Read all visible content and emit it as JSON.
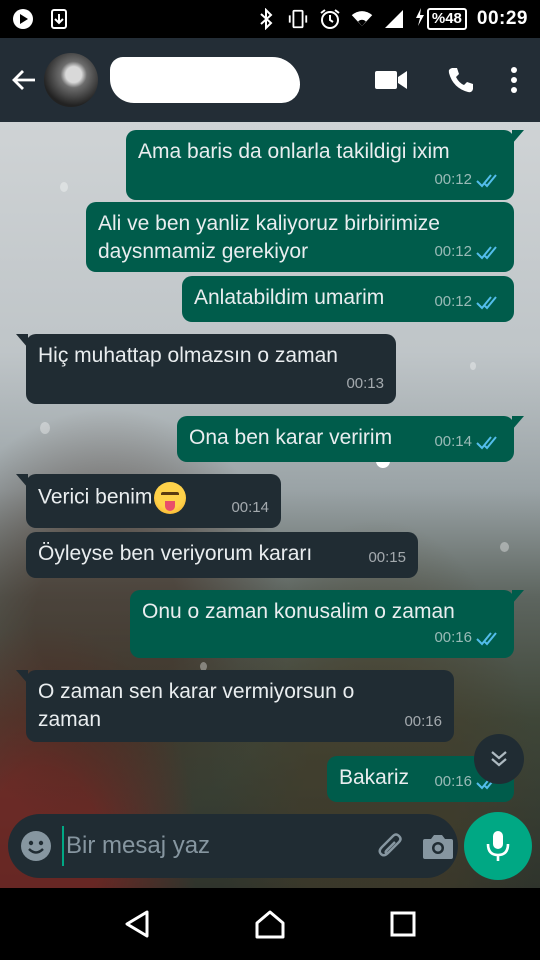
{
  "status_bar": {
    "time": "00:29",
    "battery": "%48",
    "icons": [
      "play-icon",
      "download-icon",
      "bluetooth-icon",
      "vibrate-icon",
      "alarm-icon",
      "wifi-icon",
      "signal-icon",
      "charging-icon"
    ]
  },
  "header": {
    "contact_name": "",
    "actions": [
      "video-call-icon",
      "phone-icon",
      "more-icon"
    ]
  },
  "messages": [
    {
      "direction": "out",
      "text": "Ama baris da onlarla takildigi ixim",
      "time": "00:12",
      "status": "read"
    },
    {
      "direction": "out",
      "text": "Ali ve ben yanliz kaliyoruz birbirimize daysnmamiz gerekiyor",
      "time": "00:12",
      "status": "read"
    },
    {
      "direction": "out",
      "text": "Anlatabildim umarim",
      "time": "00:12",
      "status": "read"
    },
    {
      "direction": "in",
      "text": "Hiç muhattap olmazsın o zaman",
      "time": "00:13"
    },
    {
      "direction": "out",
      "text": "Ona ben karar veririm",
      "time": "00:14",
      "status": "read"
    },
    {
      "direction": "in",
      "text": "Verici benim",
      "emoji": "squinting-tongue-emoji",
      "time": "00:14"
    },
    {
      "direction": "in",
      "text": "Öyleyse ben veriyorum kararı",
      "time": "00:15"
    },
    {
      "direction": "out",
      "text": "Onu o zaman konusalim o zaman",
      "time": "00:16",
      "status": "read"
    },
    {
      "direction": "in",
      "text": "O zaman sen karar vermiyorsun o zaman",
      "time": "00:16"
    },
    {
      "direction": "out",
      "text": "Bakariz",
      "time": "00:16",
      "status": "read"
    }
  ],
  "composer": {
    "placeholder": "Bir mesaj yaz",
    "value": ""
  },
  "colors": {
    "outgoing_bubble": "#005c4b",
    "incoming_bubble": "#202c33",
    "header": "#232d36",
    "accent": "#00a884",
    "read_ticks": "#53bdeb"
  }
}
